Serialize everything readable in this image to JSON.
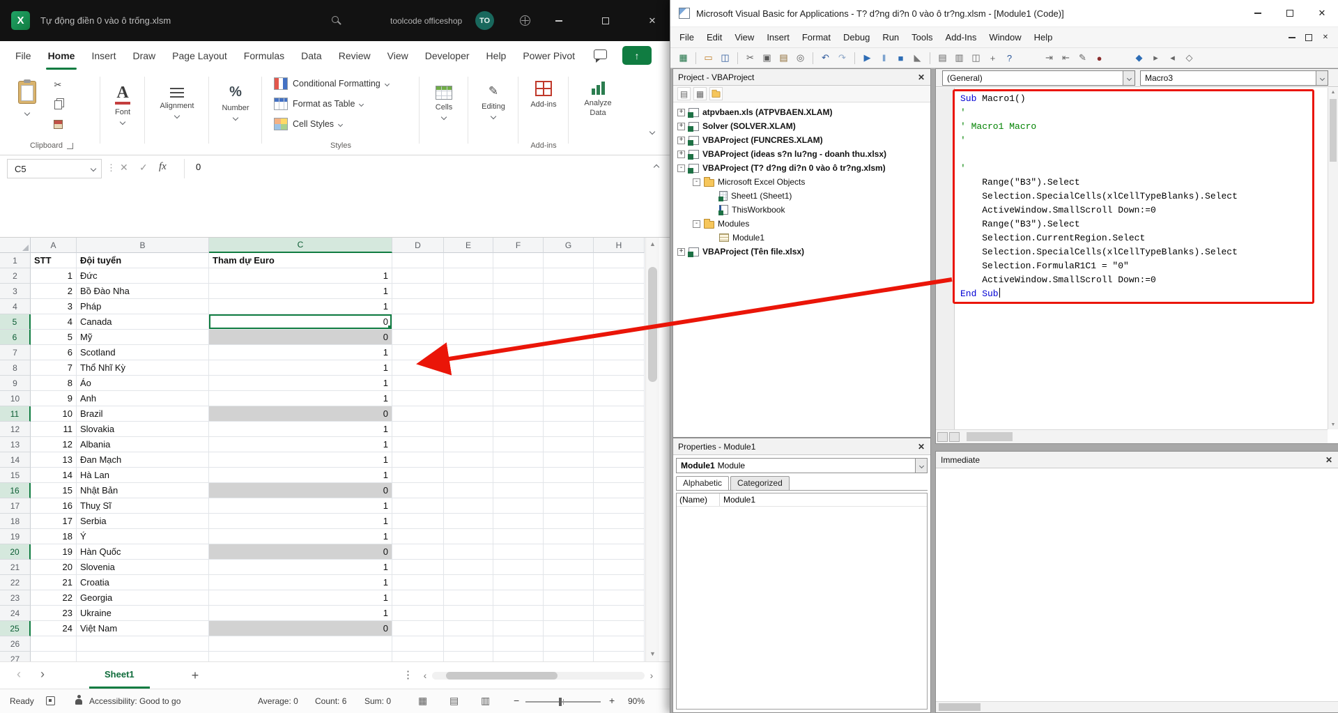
{
  "excel": {
    "titlebar": {
      "title": "Tự động điền 0 vào ô trống.xlsm",
      "account_name": "toolcode officeshop",
      "avatar_initials": "TO"
    },
    "ribbon_tabs": [
      "File",
      "Home",
      "Insert",
      "Draw",
      "Page Layout",
      "Formulas",
      "Data",
      "Review",
      "View",
      "Developer",
      "Help",
      "Power Pivot"
    ],
    "active_tab": "Home",
    "ribbon": {
      "clipboard_label": "Clipboard",
      "font_label": "Font",
      "alignment_label": "Alignment",
      "number_label": "Number",
      "conditional_formatting": "Conditional Formatting",
      "format_as_table": "Format as Table",
      "cell_styles": "Cell Styles",
      "styles_label": "Styles",
      "cells_label": "Cells",
      "editing_label": "Editing",
      "addins_button": "Add-ins",
      "addins_label": "Add-ins",
      "analyze_data": "Analyze Data"
    },
    "formula_bar": {
      "name_box": "C5",
      "fx_label": "fx",
      "value": "0"
    },
    "grid": {
      "columns": [
        "A",
        "B",
        "C",
        "D",
        "E",
        "F",
        "G",
        "H"
      ],
      "selected_column": "C",
      "selected_rows": [
        5,
        6,
        11,
        16,
        20,
        25
      ],
      "active_cell_row": 5,
      "header_row": [
        "STT",
        "Đội tuyển",
        "Tham dự Euro"
      ],
      "rows": [
        {
          "stt": 1,
          "team": "Đức",
          "euro": 1
        },
        {
          "stt": 2,
          "team": "Bồ Đào Nha",
          "euro": 1
        },
        {
          "stt": 3,
          "team": "Pháp",
          "euro": 1
        },
        {
          "stt": 4,
          "team": "Canada",
          "euro": 0
        },
        {
          "stt": 5,
          "team": "Mỹ",
          "euro": 0
        },
        {
          "stt": 6,
          "team": "Scotland",
          "euro": 1
        },
        {
          "stt": 7,
          "team": "Thổ Nhĩ Kỳ",
          "euro": 1
        },
        {
          "stt": 8,
          "team": "Áo",
          "euro": 1
        },
        {
          "stt": 9,
          "team": "Anh",
          "euro": 1
        },
        {
          "stt": 10,
          "team": "Brazil",
          "euro": 0
        },
        {
          "stt": 11,
          "team": "Slovakia",
          "euro": 1
        },
        {
          "stt": 12,
          "team": "Albania",
          "euro": 1
        },
        {
          "stt": 13,
          "team": "Đan Mạch",
          "euro": 1
        },
        {
          "stt": 14,
          "team": "Hà Lan",
          "euro": 1
        },
        {
          "stt": 15,
          "team": "Nhật Bản",
          "euro": 0
        },
        {
          "stt": 16,
          "team": "Thuỵ Sĩ",
          "euro": 1
        },
        {
          "stt": 17,
          "team": "Serbia",
          "euro": 1
        },
        {
          "stt": 18,
          "team": "Ý",
          "euro": 1
        },
        {
          "stt": 19,
          "team": "Hàn Quốc",
          "euro": 0
        },
        {
          "stt": 20,
          "team": "Slovenia",
          "euro": 1
        },
        {
          "stt": 21,
          "team": "Croatia",
          "euro": 1
        },
        {
          "stt": 22,
          "team": "Georgia",
          "euro": 1
        },
        {
          "stt": 23,
          "team": "Ukraine",
          "euro": 1
        },
        {
          "stt": 24,
          "team": "Việt Nam",
          "euro": 0
        }
      ],
      "total_rows": 27
    },
    "sheet_bar": {
      "sheet_name": "Sheet1"
    },
    "status_bar": {
      "mode": "Ready",
      "accessibility": "Accessibility: Good to go",
      "average": "Average: 0",
      "count": "Count: 6",
      "sum": "Sum: 0",
      "zoom": "90%"
    }
  },
  "vba": {
    "title": "Microsoft Visual Basic for Applications - T? d?ng di?n 0 vào ô tr?ng.xlsm - [Module1 (Code)]",
    "menu": [
      "File",
      "Edit",
      "View",
      "Insert",
      "Format",
      "Debug",
      "Run",
      "Tools",
      "Add-Ins",
      "Window",
      "Help"
    ],
    "toolbar_icons": [
      {
        "name": "view-excel-icon",
        "glyph": "▦",
        "color": "#1e7145"
      },
      {
        "name": "sep"
      },
      {
        "name": "insert-userform-icon",
        "glyph": "▭",
        "color": "#c07f2a"
      },
      {
        "name": "save-icon",
        "glyph": "◫",
        "color": "#2b579a"
      },
      {
        "name": "sep"
      },
      {
        "name": "cut-icon",
        "glyph": "✂",
        "color": "#5a5a5a"
      },
      {
        "name": "copy-icon",
        "glyph": "▣",
        "color": "#5a5a5a"
      },
      {
        "name": "paste-icon",
        "glyph": "▤",
        "color": "#8d6b35"
      },
      {
        "name": "find-icon",
        "glyph": "◎",
        "color": "#5a5a5a"
      },
      {
        "name": "sep"
      },
      {
        "name": "undo-icon",
        "glyph": "↶",
        "color": "#2b579a"
      },
      {
        "name": "redo-icon",
        "glyph": "↷",
        "color": "#8fa8c8"
      },
      {
        "name": "sep"
      },
      {
        "name": "run-icon",
        "glyph": "▶",
        "color": "#2e6db5"
      },
      {
        "name": "break-icon",
        "glyph": "‖",
        "color": "#2e6db5"
      },
      {
        "name": "reset-icon",
        "glyph": "■",
        "color": "#2e6db5"
      },
      {
        "name": "design-mode-icon",
        "glyph": "◣",
        "color": "#777777"
      },
      {
        "name": "sep"
      },
      {
        "name": "project-explorer-icon",
        "glyph": "▤",
        "color": "#666666"
      },
      {
        "name": "properties-window-icon",
        "glyph": "▥",
        "color": "#666666"
      },
      {
        "name": "object-browser-icon",
        "glyph": "◫",
        "color": "#666666"
      },
      {
        "name": "toolbox-icon",
        "glyph": "+",
        "color": "#666666"
      },
      {
        "name": "help-icon",
        "glyph": "?",
        "color": "#2b579a"
      },
      {
        "name": "gap"
      },
      {
        "name": "indent-icon",
        "glyph": "⇥",
        "color": "#666666"
      },
      {
        "name": "outdent-icon",
        "glyph": "⇤",
        "color": "#666666"
      },
      {
        "name": "comment-block-icon",
        "glyph": "✎",
        "color": "#666666"
      },
      {
        "name": "breakpoint-icon",
        "glyph": "●",
        "color": "#8b2e2e"
      },
      {
        "name": "gap"
      },
      {
        "name": "bookmark-icon",
        "glyph": "◆",
        "color": "#2e6db5"
      },
      {
        "name": "next-bookmark-icon",
        "glyph": "▸",
        "color": "#666666"
      },
      {
        "name": "prev-bookmark-icon",
        "glyph": "◂",
        "color": "#666666"
      },
      {
        "name": "clear-bookmarks-icon",
        "glyph": "◇",
        "color": "#666666"
      }
    ],
    "project_panel": {
      "title": "Project - VBAProject",
      "tree": [
        {
          "label": "atpvbaen.xls (ATPVBAEN.XLAM)",
          "depth": 0,
          "toggle": "+",
          "icon": "project",
          "bold": true
        },
        {
          "label": "Solver (SOLVER.XLAM)",
          "depth": 0,
          "toggle": "+",
          "icon": "project",
          "bold": true
        },
        {
          "label": "VBAProject (FUNCRES.XLAM)",
          "depth": 0,
          "toggle": "+",
          "icon": "project",
          "bold": true
        },
        {
          "label": "VBAProject (ideas s?n lu?ng - doanh thu.xlsx)",
          "depth": 0,
          "toggle": "+",
          "icon": "project",
          "bold": true
        },
        {
          "label": "VBAProject (T? d?ng di?n 0 vào ô tr?ng.xlsm)",
          "depth": 0,
          "toggle": "-",
          "icon": "project",
          "bold": true
        },
        {
          "label": "Microsoft Excel Objects",
          "depth": 1,
          "toggle": "-",
          "icon": "folder",
          "bold": false
        },
        {
          "label": "Sheet1 (Sheet1)",
          "depth": 2,
          "toggle": null,
          "icon": "sheet",
          "bold": false
        },
        {
          "label": "ThisWorkbook",
          "depth": 2,
          "toggle": null,
          "icon": "book",
          "bold": false
        },
        {
          "label": "Modules",
          "depth": 1,
          "toggle": "-",
          "icon": "folder",
          "bold": false
        },
        {
          "label": "Module1",
          "depth": 2,
          "toggle": null,
          "icon": "module",
          "bold": false
        },
        {
          "label": "VBAProject (Tên file.xlsx)",
          "depth": 0,
          "toggle": "+",
          "icon": "project",
          "bold": true
        }
      ]
    },
    "properties_panel": {
      "title": "Properties - Module1",
      "object_name": "Module1",
      "object_type": "Module",
      "tab_alphabetic": "Alphabetic",
      "tab_categorized": "Categorized",
      "rows": [
        {
          "name": "(Name)",
          "value": "Module1"
        }
      ]
    },
    "code_window": {
      "object_dropdown": "(General)",
      "procedure_dropdown": "Macro3",
      "lines": [
        "Sub Macro1()",
        "'",
        "' Macro1 Macro",
        "'",
        "",
        "'",
        "    Range(\"B3\").Select",
        "    Selection.SpecialCells(xlCellTypeBlanks).Select",
        "    ActiveWindow.SmallScroll Down:=0",
        "    Range(\"B3\").Select",
        "    Selection.CurrentRegion.Select",
        "    Selection.SpecialCells(xlCellTypeBlanks).Select",
        "    Selection.FormulaR1C1 = \"0\"",
        "    ActiveWindow.SmallScroll Down:=0",
        "End Sub"
      ]
    },
    "immediate_panel": {
      "title": "Immediate"
    }
  },
  "colors": {
    "excel_green": "#107c41",
    "annotation_red": "#ea1508",
    "keyword_blue": "#0000d4",
    "comment_green": "#008200",
    "selection_gray": "#d2d2d2"
  }
}
